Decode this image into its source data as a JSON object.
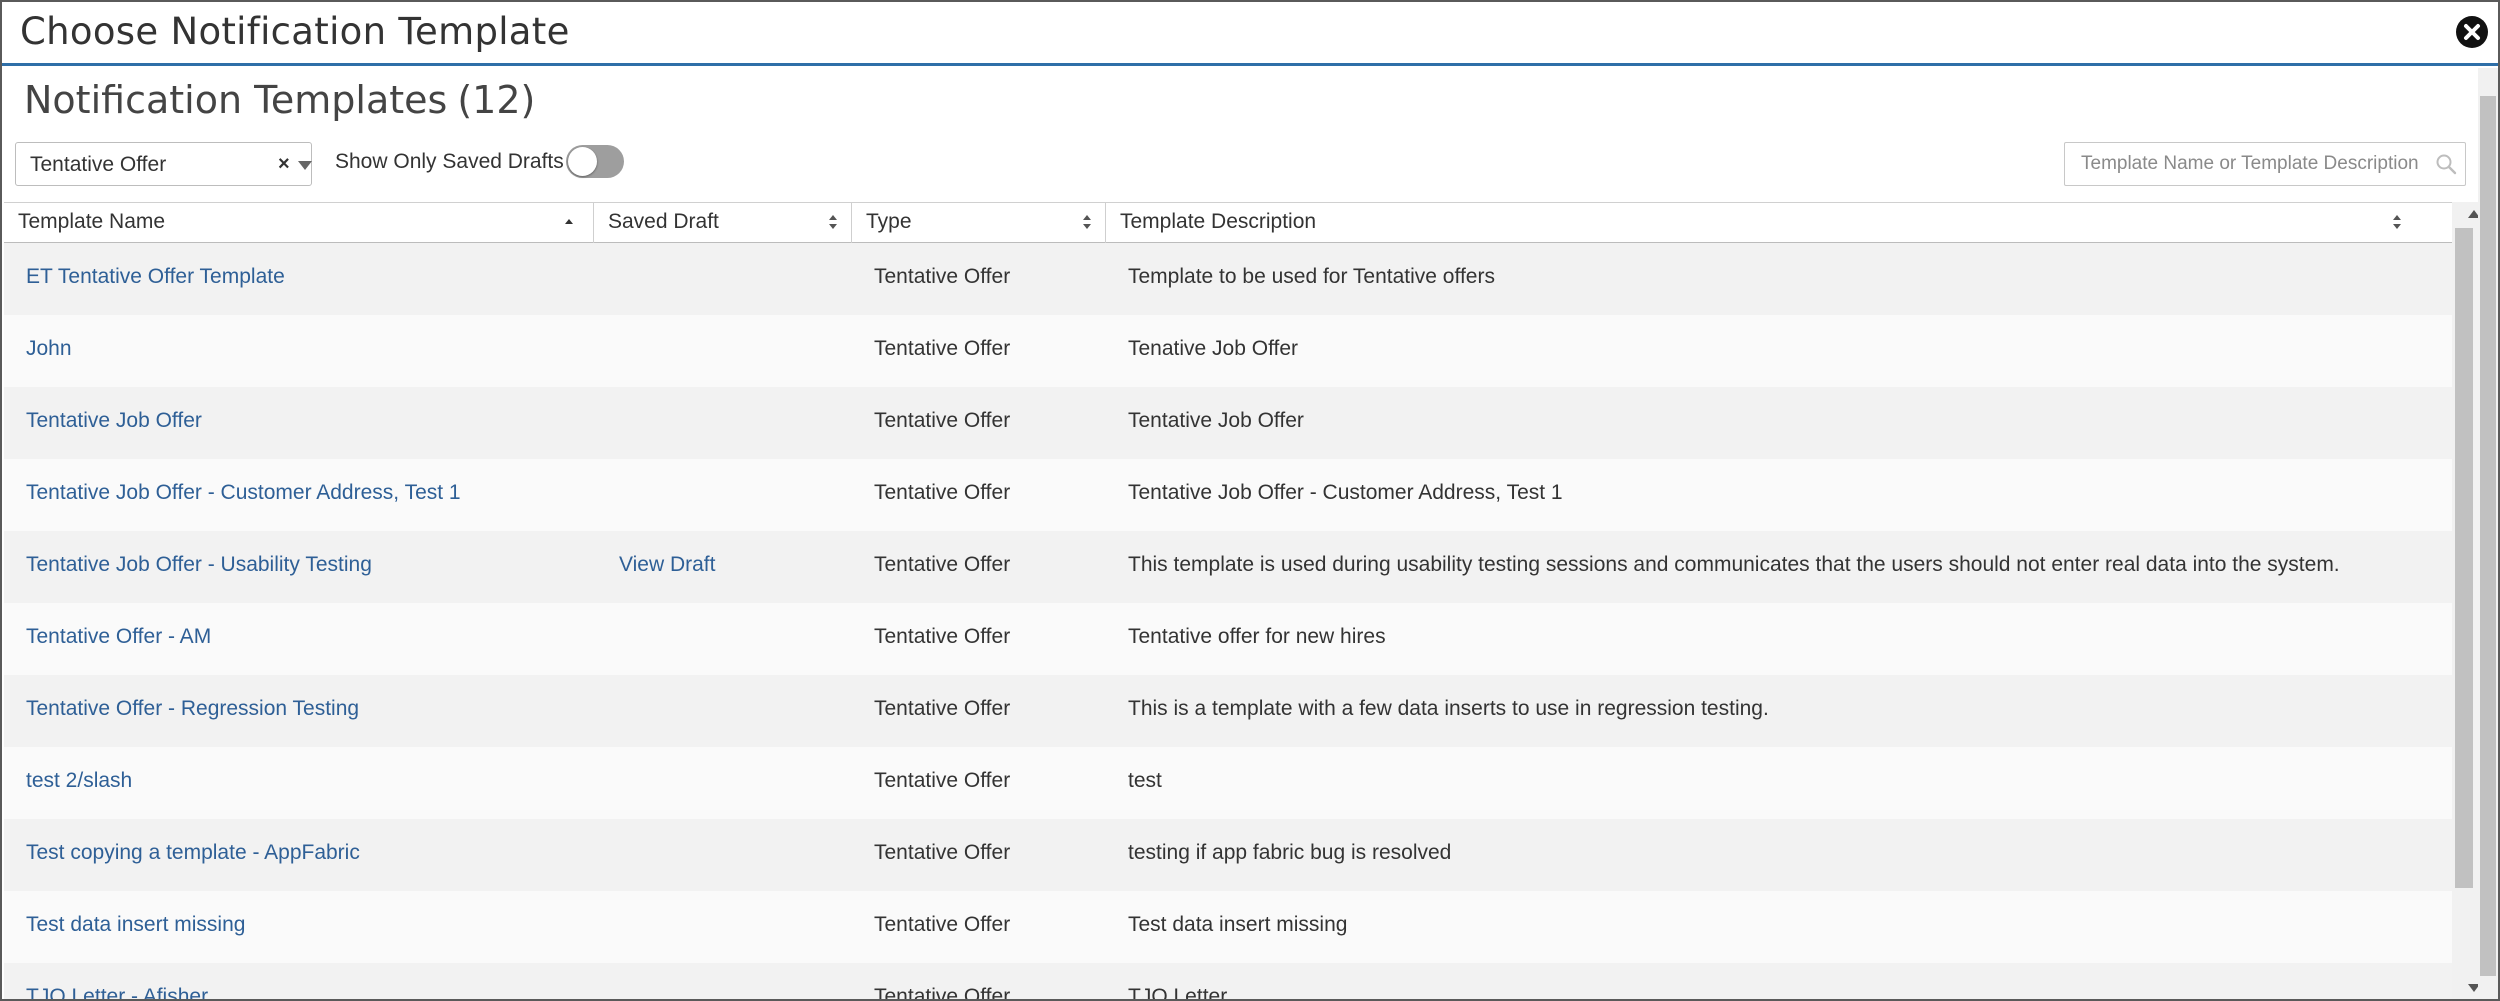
{
  "dialog": {
    "title": "Choose Notification Template",
    "close_label": "close"
  },
  "heading": {
    "text": "Notification Templates",
    "count": "(12)"
  },
  "filters": {
    "type_filter_value": "Tentative Offer",
    "clear_symbol": "×",
    "show_drafts_label": "Show Only Saved Drafts",
    "show_drafts_on": false
  },
  "search": {
    "placeholder": "Template Name or Template Description",
    "value": ""
  },
  "table": {
    "columns": [
      "Template Name",
      "Saved Draft",
      "Type",
      "Template Description"
    ],
    "rows": [
      {
        "name": "ET Tentative Offer Template",
        "draft": "",
        "type": "Tentative Offer",
        "desc": "Template to be used for Tentative offers"
      },
      {
        "name": "John",
        "draft": "",
        "type": "Tentative Offer",
        "desc": "Tenative Job Offer"
      },
      {
        "name": "Tentative Job Offer",
        "draft": "",
        "type": "Tentative Offer",
        "desc": "Tentative Job Offer"
      },
      {
        "name": "Tentative Job Offer - Customer Address, Test 1",
        "draft": "",
        "type": "Tentative Offer",
        "desc": "Tentative Job Offer - Customer Address, Test 1"
      },
      {
        "name": "Tentative Job Offer - Usability Testing",
        "draft": "View Draft",
        "type": "Tentative Offer",
        "desc": "This template is used during usability testing sessions and communicates that the users should not enter real data into the system."
      },
      {
        "name": "Tentative Offer - AM",
        "draft": "",
        "type": "Tentative Offer",
        "desc": "Tentative offer for new hires"
      },
      {
        "name": "Tentative Offer - Regression Testing",
        "draft": "",
        "type": "Tentative Offer",
        "desc": "This is a template with a few data inserts to use in regression testing."
      },
      {
        "name": "test 2/slash",
        "draft": "",
        "type": "Tentative Offer",
        "desc": "test"
      },
      {
        "name": "Test copying a template - AppFabric",
        "draft": "",
        "type": "Tentative Offer",
        "desc": "testing if app fabric bug is resolved"
      },
      {
        "name": "Test data insert missing",
        "draft": "",
        "type": "Tentative Offer",
        "desc": "Test data insert missing"
      },
      {
        "name": "TJO Letter - Afisher",
        "draft": "",
        "type": "Tentative Offer",
        "desc": "TJO Letter"
      }
    ]
  },
  "colors": {
    "link": "#2e5f96",
    "title_border": "#2f6fa8",
    "row_odd": "#f2f2f2",
    "row_even": "#fafafa"
  }
}
